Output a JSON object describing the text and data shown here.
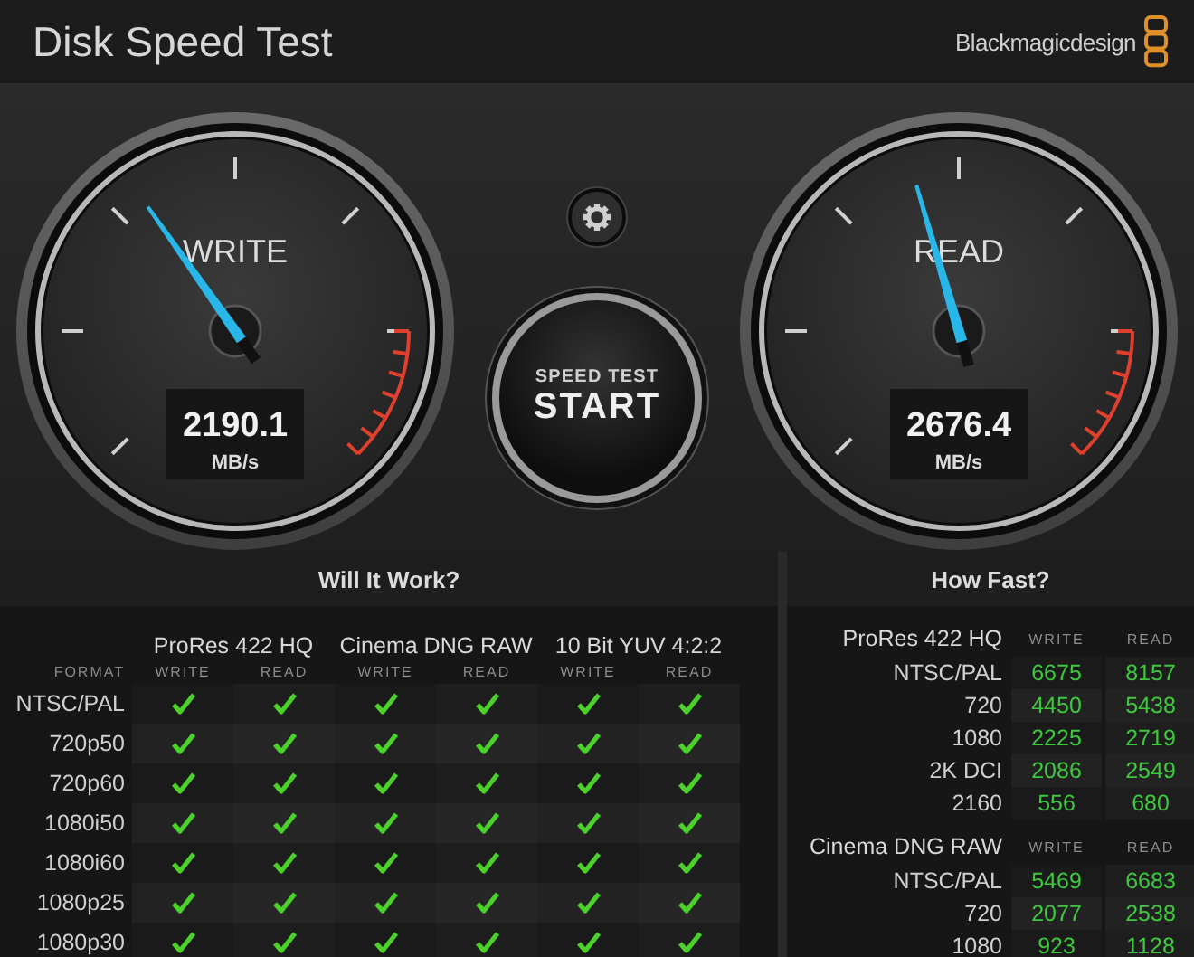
{
  "app": {
    "title": "Disk Speed Test",
    "brand": "Blackmagicdesign"
  },
  "gauges": [
    {
      "label": "WRITE",
      "value": "2190.1",
      "unit": "MB/s",
      "level": 0.37
    },
    {
      "label": "READ",
      "value": "2676.4",
      "unit": "MB/s",
      "level": 0.44
    }
  ],
  "start_button": {
    "caption": "SPEED TEST",
    "label": "START"
  },
  "will_it_work": {
    "title": "Will It Work?",
    "format_label": "FORMAT",
    "codecs": [
      {
        "name": "ProRes 422 HQ",
        "columns": [
          "WRITE",
          "READ"
        ]
      },
      {
        "name": "Cinema DNG RAW",
        "columns": [
          "WRITE",
          "READ"
        ]
      },
      {
        "name": "10 Bit YUV 4:2:2",
        "columns": [
          "WRITE",
          "READ"
        ]
      }
    ],
    "rows": [
      {
        "format": "NTSC/PAL",
        "checks": [
          true,
          true,
          true,
          true,
          true,
          true
        ]
      },
      {
        "format": "720p50",
        "checks": [
          true,
          true,
          true,
          true,
          true,
          true
        ]
      },
      {
        "format": "720p60",
        "checks": [
          true,
          true,
          true,
          true,
          true,
          true
        ]
      },
      {
        "format": "1080i50",
        "checks": [
          true,
          true,
          true,
          true,
          true,
          true
        ]
      },
      {
        "format": "1080i60",
        "checks": [
          true,
          true,
          true,
          true,
          true,
          true
        ]
      },
      {
        "format": "1080p25",
        "checks": [
          true,
          true,
          true,
          true,
          true,
          true
        ]
      },
      {
        "format": "1080p30",
        "checks": [
          true,
          true,
          true,
          true,
          true,
          true
        ]
      }
    ]
  },
  "how_fast": {
    "title": "How Fast?",
    "groups": [
      {
        "name": "ProRes 422 HQ",
        "columns": [
          "WRITE",
          "READ"
        ],
        "rows": [
          {
            "format": "NTSC/PAL",
            "write": "6675",
            "read": "8157"
          },
          {
            "format": "720",
            "write": "4450",
            "read": "5438"
          },
          {
            "format": "1080",
            "write": "2225",
            "read": "2719"
          },
          {
            "format": "2K DCI",
            "write": "2086",
            "read": "2549"
          },
          {
            "format": "2160",
            "write": "556",
            "read": "680"
          }
        ]
      },
      {
        "name": "Cinema DNG RAW",
        "columns": [
          "WRITE",
          "READ"
        ],
        "rows": [
          {
            "format": "NTSC/PAL",
            "write": "5469",
            "read": "6683"
          },
          {
            "format": "720",
            "write": "2077",
            "read": "2538"
          },
          {
            "format": "1080",
            "write": "923",
            "read": "1128"
          }
        ]
      }
    ]
  }
}
